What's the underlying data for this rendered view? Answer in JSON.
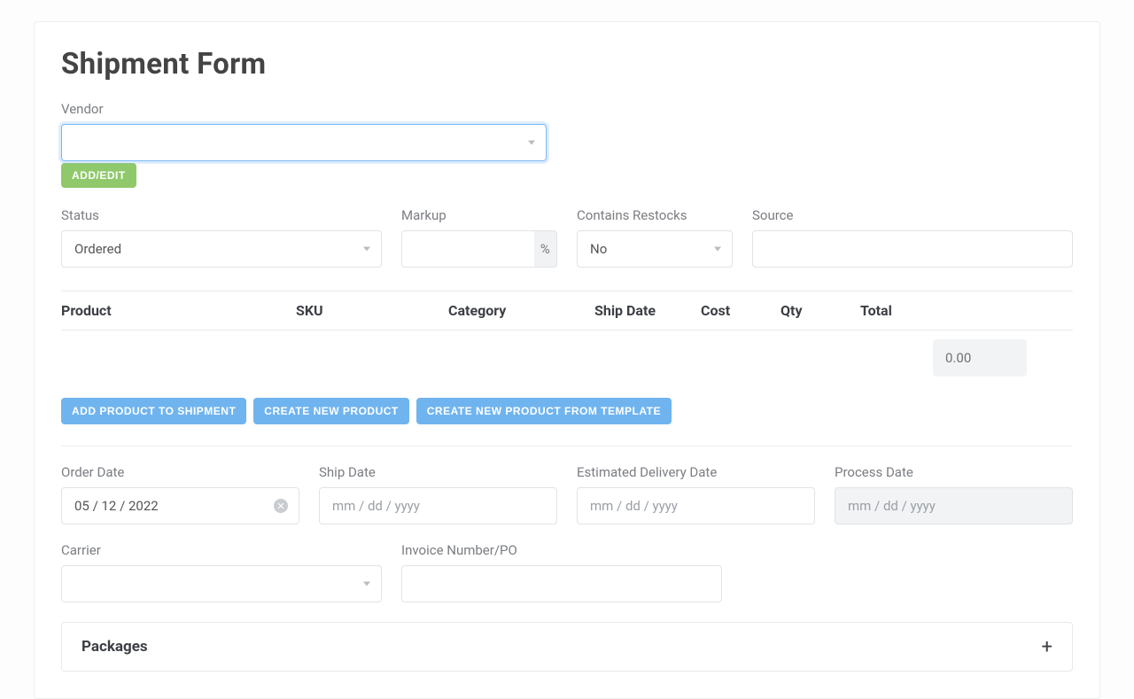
{
  "title": "Shipment Form",
  "vendor": {
    "label": "Vendor",
    "value": "",
    "addEditLabel": "ADD/EDIT"
  },
  "status": {
    "label": "Status",
    "value": "Ordered"
  },
  "markup": {
    "label": "Markup",
    "value": "",
    "suffix": "%"
  },
  "restocks": {
    "label": "Contains Restocks",
    "value": "No"
  },
  "source": {
    "label": "Source",
    "value": ""
  },
  "table": {
    "headers": {
      "product": "Product",
      "sku": "SKU",
      "category": "Category",
      "shipDate": "Ship Date",
      "cost": "Cost",
      "qty": "Qty",
      "total": "Total"
    },
    "totalValue": "0.00"
  },
  "actions": {
    "addProduct": "ADD PRODUCT TO SHIPMENT",
    "createProduct": "CREATE NEW PRODUCT",
    "createFromTemplate": "CREATE NEW PRODUCT FROM TEMPLATE"
  },
  "dates": {
    "order": {
      "label": "Order Date",
      "value": "05 / 12 / 2022"
    },
    "ship": {
      "label": "Ship Date",
      "placeholder": "mm / dd / yyyy"
    },
    "edd": {
      "label": "Estimated Delivery Date",
      "placeholder": "mm / dd / yyyy"
    },
    "process": {
      "label": "Process Date",
      "placeholder": "mm / dd / yyyy"
    }
  },
  "carrier": {
    "label": "Carrier",
    "value": ""
  },
  "invoice": {
    "label": "Invoice Number/PO",
    "value": ""
  },
  "packages": {
    "label": "Packages"
  }
}
